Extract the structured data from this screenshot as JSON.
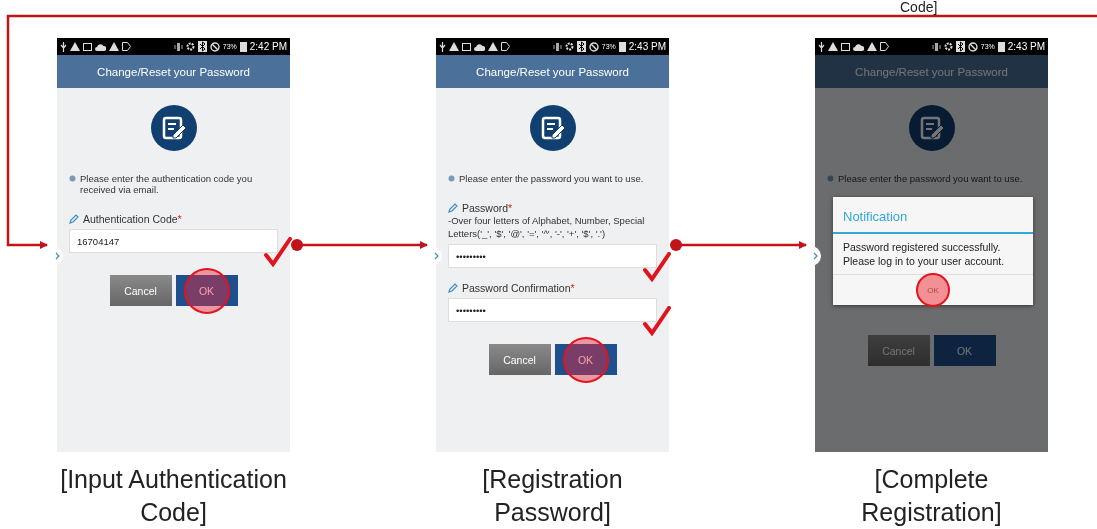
{
  "loop_caption_fragment": "Code]",
  "steps": [
    {
      "status_bar": {
        "battery": "73%",
        "time": "2:42 PM"
      },
      "header": {
        "title": "Change/Reset your Password"
      },
      "instruction": "Please enter the authentication code you received via email.",
      "dimmed": false,
      "fields": [
        {
          "label": "Authentication Code",
          "required_mark": "*",
          "value": "16704147",
          "checked": true
        }
      ],
      "buttons": [
        {
          "label": "Cancel",
          "kind": "cancel",
          "highlighted": false
        },
        {
          "label": "OK",
          "kind": "ok",
          "highlighted": true
        }
      ],
      "caption": "[Input Authentication\nCode]"
    },
    {
      "status_bar": {
        "battery": "73%",
        "time": "2:43 PM"
      },
      "header": {
        "title": "Change/Reset your Password"
      },
      "instruction": "Please enter the password you want to use.",
      "dimmed": false,
      "fields": [
        {
          "label": "Password",
          "required_mark": "*",
          "hint": "-Over four letters of Alphabet, Number, Special Letters('_', '$', '@', '=', '^', '-', '+', '$', '.')",
          "value": "•••••••••",
          "checked": true
        },
        {
          "label": "Password Confirmation",
          "required_mark": "*",
          "value": "•••••••••",
          "checked": true
        }
      ],
      "buttons": [
        {
          "label": "Cancel",
          "kind": "cancel",
          "highlighted": false
        },
        {
          "label": "OK",
          "kind": "ok",
          "highlighted": true
        }
      ],
      "caption": "[Registration\nPassword]"
    },
    {
      "status_bar": {
        "battery": "73%",
        "time": "2:43 PM"
      },
      "header": {
        "title": "Change/Reset your Password"
      },
      "instruction": "Please enter the password you want to use.",
      "dimmed": true,
      "buttons": [
        {
          "label": "Cancel",
          "kind": "cancel",
          "highlighted": false
        },
        {
          "label": "OK",
          "kind": "ok",
          "highlighted": false
        }
      ],
      "dialog": {
        "title": "Notification",
        "message": "Password registered successfully.\nPlease log in to your user account.",
        "button": {
          "label": "OK",
          "highlighted": true
        }
      },
      "caption": "[Complete\nRegistration]"
    }
  ]
}
